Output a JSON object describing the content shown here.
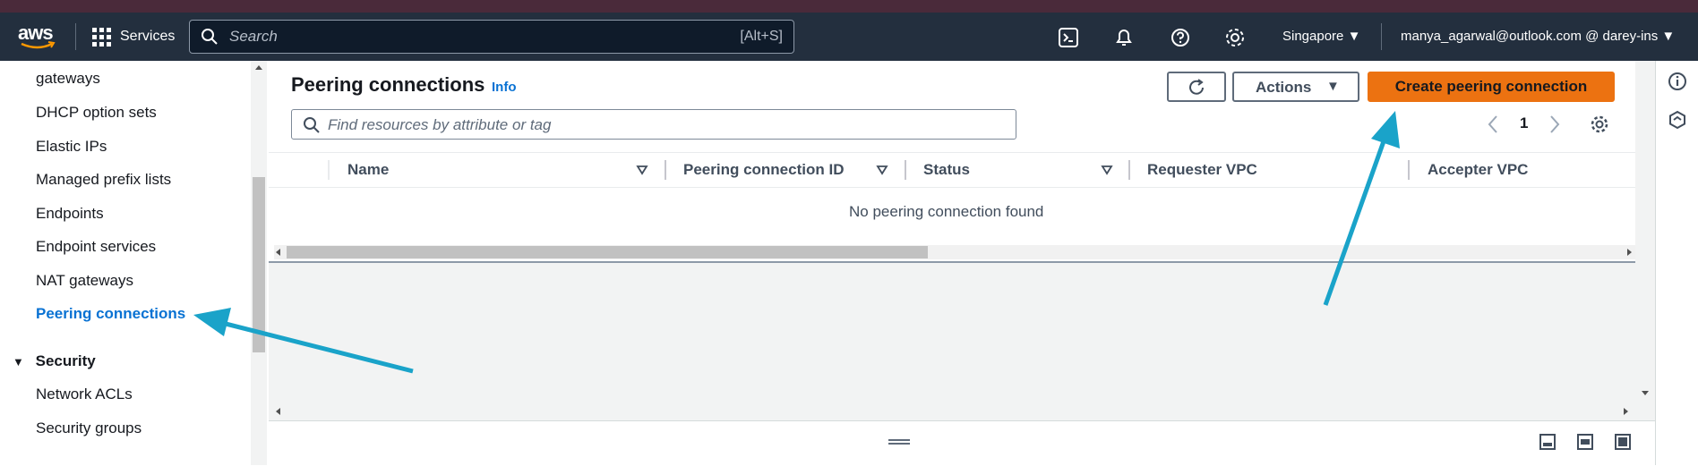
{
  "header": {
    "logo_text": "aws",
    "services_label": "Services",
    "search_placeholder": "Search",
    "search_shortcut": "[Alt+S]",
    "region": "Singapore",
    "account": "manya_agarwal@outlook.com @ darey-ins"
  },
  "sidebar": {
    "items": [
      {
        "label": "gateways"
      },
      {
        "label": "DHCP option sets"
      },
      {
        "label": "Elastic IPs"
      },
      {
        "label": "Managed prefix lists"
      },
      {
        "label": "Endpoints"
      },
      {
        "label": "Endpoint services"
      },
      {
        "label": "NAT gateways"
      },
      {
        "label": "Peering connections",
        "active": true
      }
    ],
    "security_section": {
      "title": "Security",
      "items": [
        {
          "label": "Network ACLs"
        },
        {
          "label": "Security groups"
        }
      ]
    }
  },
  "main": {
    "title": "Peering connections",
    "info_label": "Info",
    "actions_label": "Actions",
    "create_label": "Create peering connection",
    "filter_placeholder": "Find resources by attribute or tag",
    "page_number": "1",
    "table": {
      "columns": [
        "Name",
        "Peering connection ID",
        "Status",
        "Requester VPC",
        "Accepter VPC"
      ],
      "empty_message": "No peering connection found"
    }
  },
  "colors": {
    "nav_bg": "#232f3e",
    "primary_button": "#ec7211",
    "link": "#0972d3",
    "annotation_arrow": "#1aa3c9"
  }
}
